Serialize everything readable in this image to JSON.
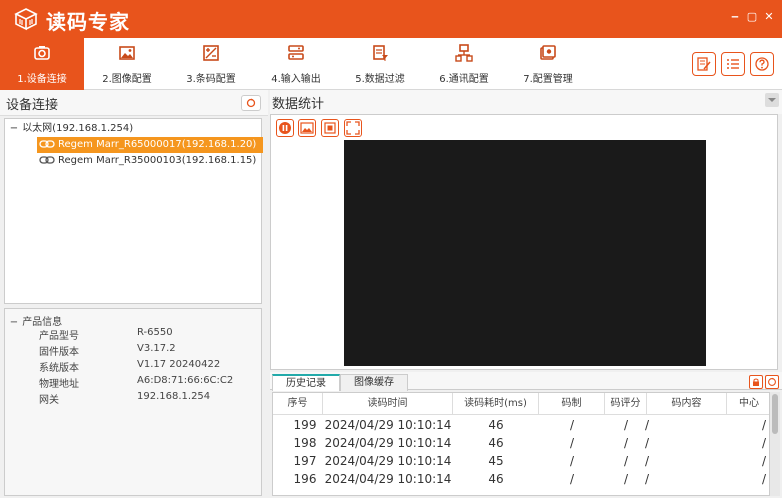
{
  "app": {
    "title": "读码专家"
  },
  "window_controls": {
    "minimize": "‒",
    "maximize": "▢",
    "close": "✕"
  },
  "toolbar": {
    "tabs": [
      {
        "label": "1.设备连接",
        "icon": "camera-icon",
        "active": true
      },
      {
        "label": "2.图像配置",
        "icon": "image-icon",
        "active": false
      },
      {
        "label": "3.条码配置",
        "icon": "barcode-config-icon",
        "active": false
      },
      {
        "label": "4.输入输出",
        "icon": "io-icon",
        "active": false
      },
      {
        "label": "5.数据过滤",
        "icon": "filter-icon",
        "active": false
      },
      {
        "label": "6.通讯配置",
        "icon": "network-icon",
        "active": false
      },
      {
        "label": "7.配置管理",
        "icon": "config-manage-icon",
        "active": false
      }
    ],
    "right_buttons": [
      "edit-icon",
      "list-icon",
      "help-icon"
    ]
  },
  "device_panel": {
    "title": "设备连接",
    "tree": {
      "root": "以太网(192.168.1.254)",
      "devices": [
        {
          "label": "Regem Marr_R65000017(192.168.1.20)",
          "selected": true
        },
        {
          "label": "Regem Marr_R35000103(192.168.1.15)",
          "selected": false
        }
      ]
    }
  },
  "product_info": {
    "title": "产品信息",
    "rows": [
      {
        "key": "产品型号",
        "value": "R-6550"
      },
      {
        "key": "固件版本",
        "value": "V3.17.2"
      },
      {
        "key": "系统版本",
        "value": "V1.17 20240422"
      },
      {
        "key": "物理地址",
        "value": "A6:D8:71:66:6C:C2"
      },
      {
        "key": "网关",
        "value": "192.168.1.254"
      }
    ]
  },
  "stats_panel": {
    "title": "数据统计"
  },
  "tabs": [
    {
      "label": "历史记录",
      "active": true
    },
    {
      "label": "图像缓存",
      "active": false
    }
  ],
  "table": {
    "columns": [
      "序号",
      "读码时间",
      "读码耗时(ms)",
      "码制",
      "码评分",
      "码内容",
      "中心"
    ],
    "rows": [
      [
        "199",
        "2024/04/29 10:10:14",
        "46",
        "/",
        "/",
        "/",
        "/"
      ],
      [
        "198",
        "2024/04/29 10:10:14",
        "46",
        "/",
        "/",
        "/",
        "/"
      ],
      [
        "197",
        "2024/04/29 10:10:14",
        "45",
        "/",
        "/",
        "/",
        "/"
      ],
      [
        "196",
        "2024/04/29 10:10:14",
        "46",
        "/",
        "/",
        "/",
        "/"
      ]
    ]
  },
  "colors": {
    "brand": "#e8541c",
    "selected_row": "#f5961e",
    "image_bg": "#1a1a1a"
  }
}
